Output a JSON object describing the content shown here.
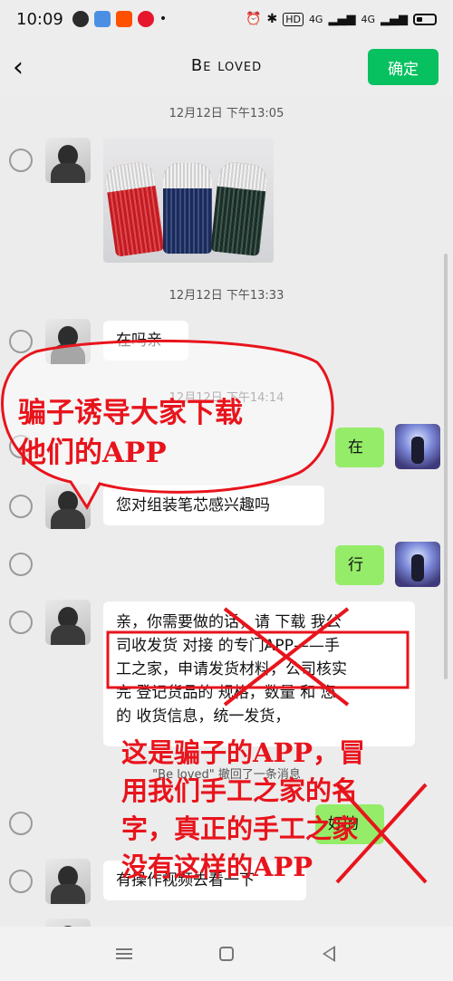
{
  "status_bar": {
    "time": "10:09",
    "signal1": "4G",
    "signal2": "4G",
    "hd_label": "HD"
  },
  "header": {
    "title": "Be loved",
    "confirm_label": "确定"
  },
  "messages": {
    "ts1": "12月12日 下午13:05",
    "ts2": "12月12日 下午13:33",
    "ts3": "12月12日 下午14:14",
    "msg_zai_ma": "在吗亲",
    "msg_zai": "在",
    "msg_interest": "您对组装笔芯感兴趣吗",
    "msg_xing": "行",
    "msg_long_lines": [
      "亲，你需要做的话，请 下载 我公",
      "司收发货 对接 的专门APP——手",
      "工之家，申请发货材料，公司核实",
      "完 登记货品的 规格，数量 和 您",
      "的  收货信息，统一发货，"
    ],
    "recall_notice": "\"Be loved\" 撤回了一条消息",
    "msg_haode": "好的",
    "msg_video": "有操作视频去看一下"
  },
  "annotations": {
    "callout_lines": [
      "骗子诱导大家下载",
      "他们的APP"
    ],
    "warning_lines": [
      "这是骗子的APP，冒",
      "用我们手工之家的名",
      "字，真正的手工之家",
      "没有这样的APP"
    ]
  },
  "colors": {
    "accent_green": "#07c160",
    "bubble_green": "#95ec69",
    "annotation_red": "#e8141c"
  }
}
